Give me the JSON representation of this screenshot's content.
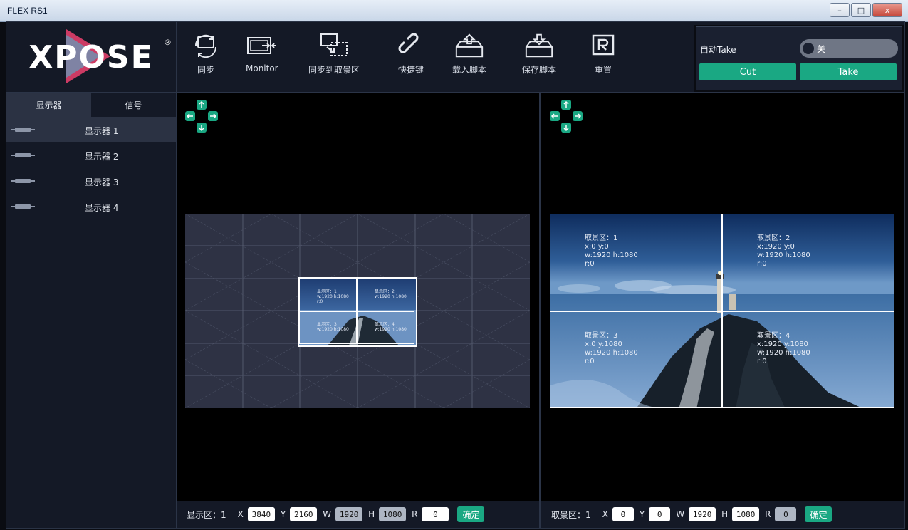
{
  "window": {
    "title": "FLEX RS1",
    "controls": [
      "–",
      "□",
      "x"
    ]
  },
  "brand": {
    "logo_text": "XPOSE",
    "registered": "®"
  },
  "toolbar": {
    "items": [
      {
        "label": "同步",
        "icon": "sync-icon"
      },
      {
        "label": "Monitor",
        "icon": "monitor-icon"
      },
      {
        "label": "同步到取景区",
        "icon": "sync-to-capture-icon"
      },
      {
        "label": "快捷键",
        "icon": "link-icon"
      },
      {
        "label": "载入脚本",
        "icon": "load-script-icon"
      },
      {
        "label": "保存脚本",
        "icon": "save-script-icon"
      },
      {
        "label": "重置",
        "icon": "reset-icon"
      }
    ]
  },
  "take_panel": {
    "auto_take_label": "自动Take",
    "toggle_label": "关",
    "toggle_on": false,
    "cut_label": "Cut",
    "take_label": "Take",
    "accent_color": "#1aa883"
  },
  "sidebar": {
    "tabs": [
      "显示器",
      "信号"
    ],
    "active_tab": 0,
    "items": [
      {
        "name": "显示器 1",
        "selected": true
      },
      {
        "name": "显示器 2",
        "selected": false
      },
      {
        "name": "显示器 3",
        "selected": false
      },
      {
        "name": "显示器 4",
        "selected": false
      }
    ]
  },
  "display_pane": {
    "cells": [
      {
        "lines": [
          "显示区：1",
          "w:1920  h:1080",
          "r:0"
        ]
      },
      {
        "lines": [
          "显示区：2",
          "w:1920  h:1080"
        ]
      },
      {
        "lines": [
          "显示区：3",
          "w:1920  h:1080"
        ]
      },
      {
        "lines": [
          "显示区：4",
          "w:1920  h:1080"
        ]
      }
    ]
  },
  "capture_pane": {
    "cells": [
      {
        "lines": [
          "取景区：1",
          "x:0  y:0",
          "w:1920  h:1080",
          "r:0"
        ]
      },
      {
        "lines": [
          "取景区：2",
          "x:1920  y:0",
          "w:1920  h:1080",
          "r:0"
        ]
      },
      {
        "lines": [
          "取景区：3",
          "x:0  y:1080",
          "w:1920  h:1080",
          "r:0"
        ]
      },
      {
        "lines": [
          "取景区：4",
          "x:1920  y:1080",
          "w:1920  h:1080",
          "r:0"
        ]
      }
    ]
  },
  "display_bar": {
    "label": "显示区：1",
    "x_label": "X",
    "x": "3840",
    "y_label": "Y",
    "y": "2160",
    "w_label": "W",
    "w": "1920",
    "h_label": "H",
    "h": "1080",
    "r_label": "R",
    "r": "0",
    "confirm": "确定"
  },
  "capture_bar": {
    "label": "取景区：1",
    "x_label": "X",
    "x": "0",
    "y_label": "Y",
    "y": "0",
    "w_label": "W",
    "w": "1920",
    "h_label": "H",
    "h": "1080",
    "r_label": "R",
    "r": "0",
    "confirm": "确定"
  }
}
